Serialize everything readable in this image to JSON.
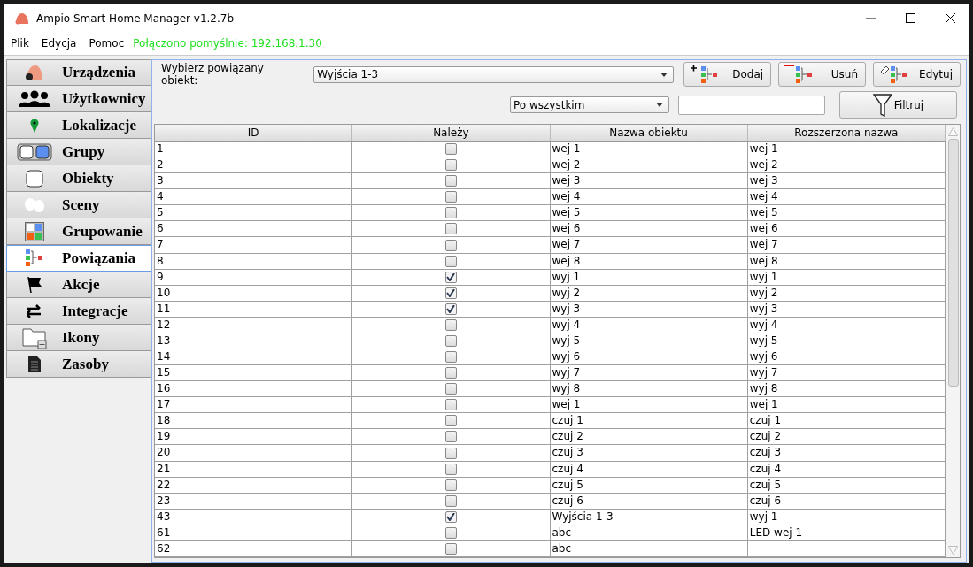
{
  "window": {
    "title": "Ampio Smart Home Manager v1.2.7b"
  },
  "menu": [
    "Plik",
    "Edycja",
    "Pomoc"
  ],
  "status": "Połączono pomyślnie: 192.168.1.30",
  "sidebar": {
    "items": [
      {
        "label": "Urządzenia",
        "selected": false
      },
      {
        "label": "Użytkownicy",
        "selected": false
      },
      {
        "label": "Lokalizacje",
        "selected": false
      },
      {
        "label": "Grupy",
        "selected": false
      },
      {
        "label": "Obiekty",
        "selected": false
      },
      {
        "label": "Sceny",
        "selected": false
      },
      {
        "label": "Grupowanie",
        "selected": false
      },
      {
        "label": "Powiązania",
        "selected": true
      },
      {
        "label": "Akcje",
        "selected": false
      },
      {
        "label": "Integracje",
        "selected": false
      },
      {
        "label": "Ikony",
        "selected": false
      },
      {
        "label": "Zasoby",
        "selected": false
      }
    ]
  },
  "toolbar": {
    "object_label": "Wybierz powiązany obiekt:",
    "object_value": "Wyjścia 1-3",
    "filter_mode": "Po wszystkim",
    "buttons": [
      "Dodaj",
      "Usuń",
      "Edytuj"
    ],
    "filter_button": "Filtruj"
  },
  "table": {
    "columns": [
      "ID",
      "Należy",
      "Nazwa obiektu",
      "Rozszerzona nazwa"
    ],
    "rows": [
      {
        "id": "1",
        "checked": false,
        "name": "wej 1",
        "ext": "wej 1"
      },
      {
        "id": "2",
        "checked": false,
        "name": "wej 2",
        "ext": "wej 2"
      },
      {
        "id": "3",
        "checked": false,
        "name": "wej 3",
        "ext": "wej 3"
      },
      {
        "id": "4",
        "checked": false,
        "name": "wej 4",
        "ext": "wej 4"
      },
      {
        "id": "5",
        "checked": false,
        "name": "wej 5",
        "ext": "wej 5"
      },
      {
        "id": "6",
        "checked": false,
        "name": "wej 6",
        "ext": "wej 6"
      },
      {
        "id": "7",
        "checked": false,
        "name": "wej 7",
        "ext": "wej 7"
      },
      {
        "id": "8",
        "checked": false,
        "name": "wej 8",
        "ext": "wej 8"
      },
      {
        "id": "9",
        "checked": true,
        "name": "wyj 1",
        "ext": "wyj 1"
      },
      {
        "id": "10",
        "checked": true,
        "name": "wyj 2",
        "ext": "wyj 2"
      },
      {
        "id": "11",
        "checked": true,
        "name": "wyj 3",
        "ext": "wyj 3"
      },
      {
        "id": "12",
        "checked": false,
        "name": "wyj 4",
        "ext": "wyj 4"
      },
      {
        "id": "13",
        "checked": false,
        "name": "wyj 5",
        "ext": "wyj 5"
      },
      {
        "id": "14",
        "checked": false,
        "name": "wyj 6",
        "ext": "wyj 6"
      },
      {
        "id": "15",
        "checked": false,
        "name": "wyj 7",
        "ext": "wyj 7"
      },
      {
        "id": "16",
        "checked": false,
        "name": "wyj 8",
        "ext": "wyj 8"
      },
      {
        "id": "17",
        "checked": false,
        "name": "wej 1",
        "ext": "wej 1"
      },
      {
        "id": "18",
        "checked": false,
        "name": "czuj 1",
        "ext": "czuj 1"
      },
      {
        "id": "19",
        "checked": false,
        "name": "czuj 2",
        "ext": "czuj 2"
      },
      {
        "id": "20",
        "checked": false,
        "name": "czuj 3",
        "ext": "czuj 3"
      },
      {
        "id": "21",
        "checked": false,
        "name": "czuj 4",
        "ext": "czuj 4"
      },
      {
        "id": "22",
        "checked": false,
        "name": "czuj 5",
        "ext": "czuj 5"
      },
      {
        "id": "23",
        "checked": false,
        "name": "czuj 6",
        "ext": "czuj 6"
      },
      {
        "id": "43",
        "checked": true,
        "name": "Wyjścia 1-3",
        "ext": "wyj 1"
      },
      {
        "id": "61",
        "checked": false,
        "name": "abc",
        "ext": "LED wej 1"
      },
      {
        "id": "62",
        "checked": false,
        "name": "abc",
        "ext": ""
      }
    ]
  }
}
